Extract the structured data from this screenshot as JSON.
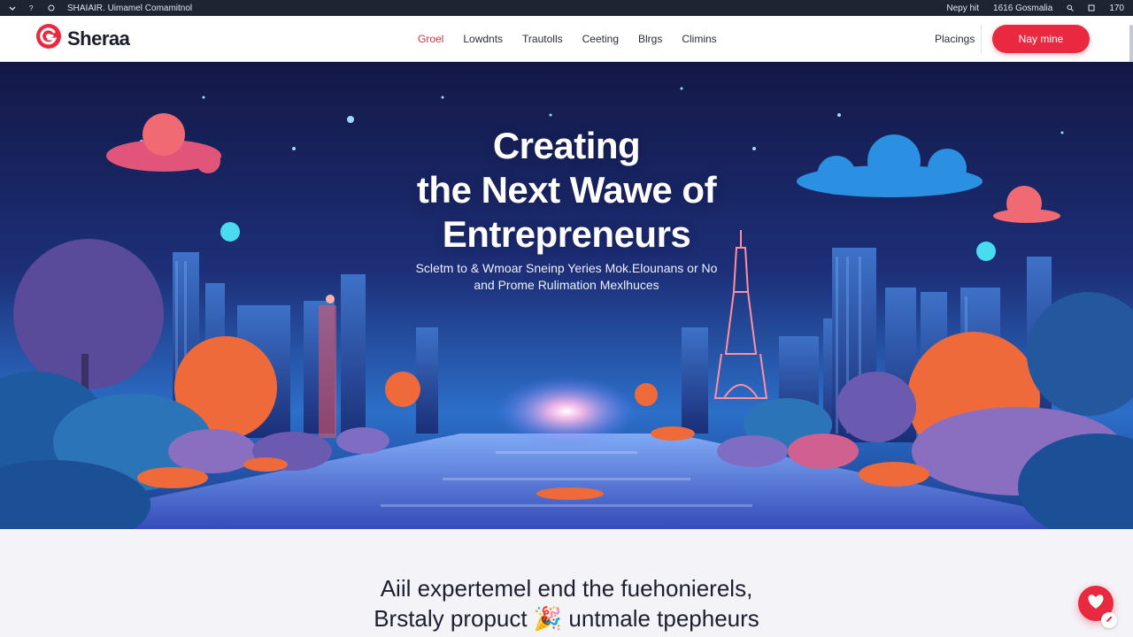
{
  "sysbar": {
    "title": "SHAIAIR. Uimamel Comamitnol",
    "right_items": [
      "Nepy hit",
      "1616 Gosmalia",
      "170"
    ]
  },
  "nav": {
    "logo_text": "Sheraa",
    "menu": [
      "Groel",
      "Lowdnts",
      "Trautolls",
      "Ceeting",
      "Blrgs",
      "Climins"
    ],
    "active_index": 0,
    "pricing": "Placings",
    "cta": "Nay mine"
  },
  "hero": {
    "title_line1": "Creating",
    "title_line2": "the Next Wawe of",
    "title_line3": "Entrepreneurs",
    "subtitle_line1": "Scletm to & Wmoar Sneinp Yeries Mok.Elounans or No",
    "subtitle_line2": "and Prome Rulimation Mexlhuces"
  },
  "section": {
    "heading_line1": "Aiil expertemel end the fuehonierels,",
    "heading_line2": "Brstaly propuct 🎉 untmale tpepheurs"
  },
  "colors": {
    "brand": "#e8293f",
    "hero_dark": "#151a4a",
    "hero_glow": "#3aa7ff"
  },
  "icons": {
    "logo": "swirl-logo-icon",
    "floating_button": "heart-icon"
  }
}
